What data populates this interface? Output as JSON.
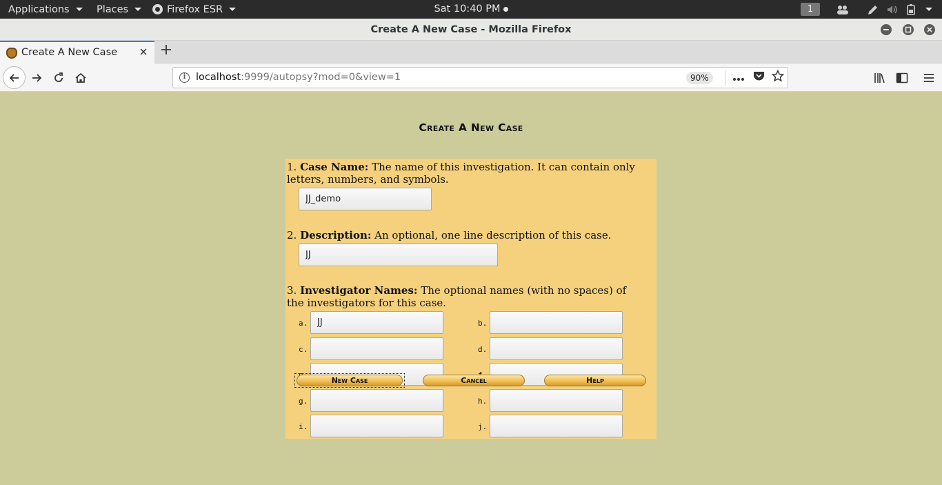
{
  "system_bar": {
    "applications": "Applications",
    "places": "Places",
    "browser_app": "Firefox ESR",
    "clock": "Sat 10:40 PM",
    "workspace": "1"
  },
  "window": {
    "title": "Create A New Case - Mozilla Firefox"
  },
  "tab": {
    "label": "Create A New Case"
  },
  "navbar": {
    "url_host": "localhost",
    "url_rest": ":9999/autopsy?mod=0&view=1",
    "zoom": "90%"
  },
  "page": {
    "title": "Create A New Case",
    "case_name": {
      "number": "1.",
      "label": "Case Name:",
      "help": "The name of this investigation. It can contain only letters, numbers, and symbols.",
      "value": "JJ_demo"
    },
    "description": {
      "number": "2.",
      "label": "Description:",
      "help": "An optional, one line description of this case.",
      "value": "JJ"
    },
    "investigators": {
      "number": "3.",
      "label": "Investigator Names:",
      "help": "The optional names (with no spaces) of the investigators for this case.",
      "fields": [
        {
          "letter": "a.",
          "value": "JJ"
        },
        {
          "letter": "b.",
          "value": ""
        },
        {
          "letter": "c.",
          "value": ""
        },
        {
          "letter": "d.",
          "value": ""
        },
        {
          "letter": "e.",
          "value": ""
        },
        {
          "letter": "f.",
          "value": ""
        },
        {
          "letter": "g.",
          "value": ""
        },
        {
          "letter": "h.",
          "value": ""
        },
        {
          "letter": "i.",
          "value": ""
        },
        {
          "letter": "j.",
          "value": ""
        }
      ]
    },
    "buttons": {
      "new_case": "New Case",
      "cancel": "Cancel",
      "help": "Help"
    }
  },
  "colors": {
    "page_bg": "#cccc9a",
    "form_bg": "#f5d17e",
    "button_gold": "#f0bf55",
    "active_tab_accent": "#0a84ff"
  }
}
